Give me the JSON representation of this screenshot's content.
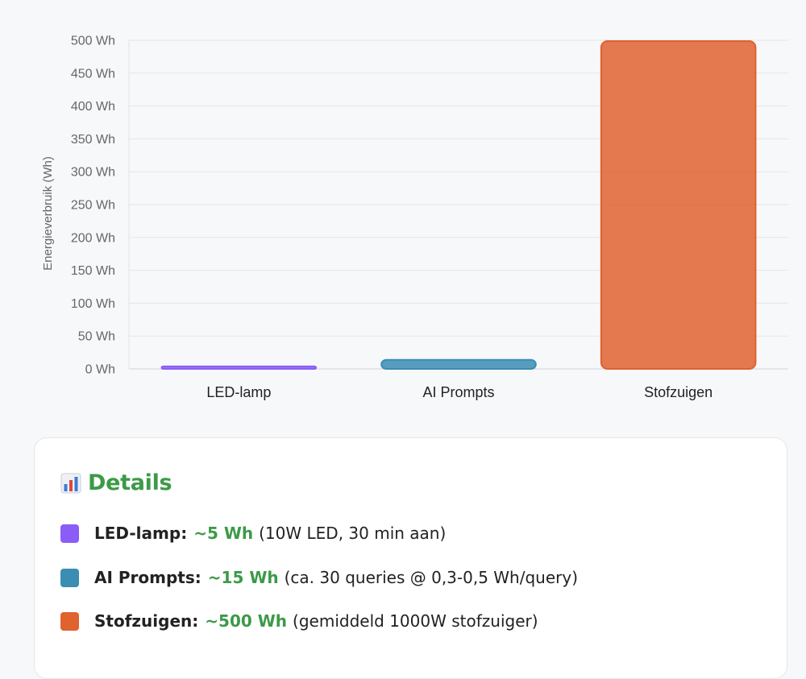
{
  "chart_data": {
    "type": "bar",
    "categories": [
      "LED-lamp",
      "AI Prompts",
      "Stofzuigen"
    ],
    "values": [
      5,
      15,
      500
    ],
    "colors": [
      "#8b5cf6",
      "#3a8db3",
      "#e0622f"
    ],
    "title": "",
    "xlabel": "",
    "ylabel": "Energieverbruik (Wh)",
    "ylim": [
      0,
      500
    ],
    "yticks": [
      "0 Wh",
      "50 Wh",
      "100 Wh",
      "150 Wh",
      "200 Wh",
      "250 Wh",
      "300 Wh",
      "350 Wh",
      "400 Wh",
      "450 Wh",
      "500 Wh"
    ],
    "grid": true,
    "legend": false
  },
  "details": {
    "title": "Details",
    "icon": "bar-chart-icon",
    "items": [
      {
        "label": "LED-lamp:",
        "value": "~5 Wh",
        "note": "(10W LED, 30 min aan)",
        "color": "#8b5cf6"
      },
      {
        "label": "AI Prompts:",
        "value": "~15 Wh",
        "note": "(ca. 30 queries @ 0,3-0,5 Wh/query)",
        "color": "#3a8db3"
      },
      {
        "label": "Stofzuigen:",
        "value": "~500 Wh",
        "note": "(gemiddeld 1000W stofzuiger)",
        "color": "#e0622f"
      }
    ]
  }
}
